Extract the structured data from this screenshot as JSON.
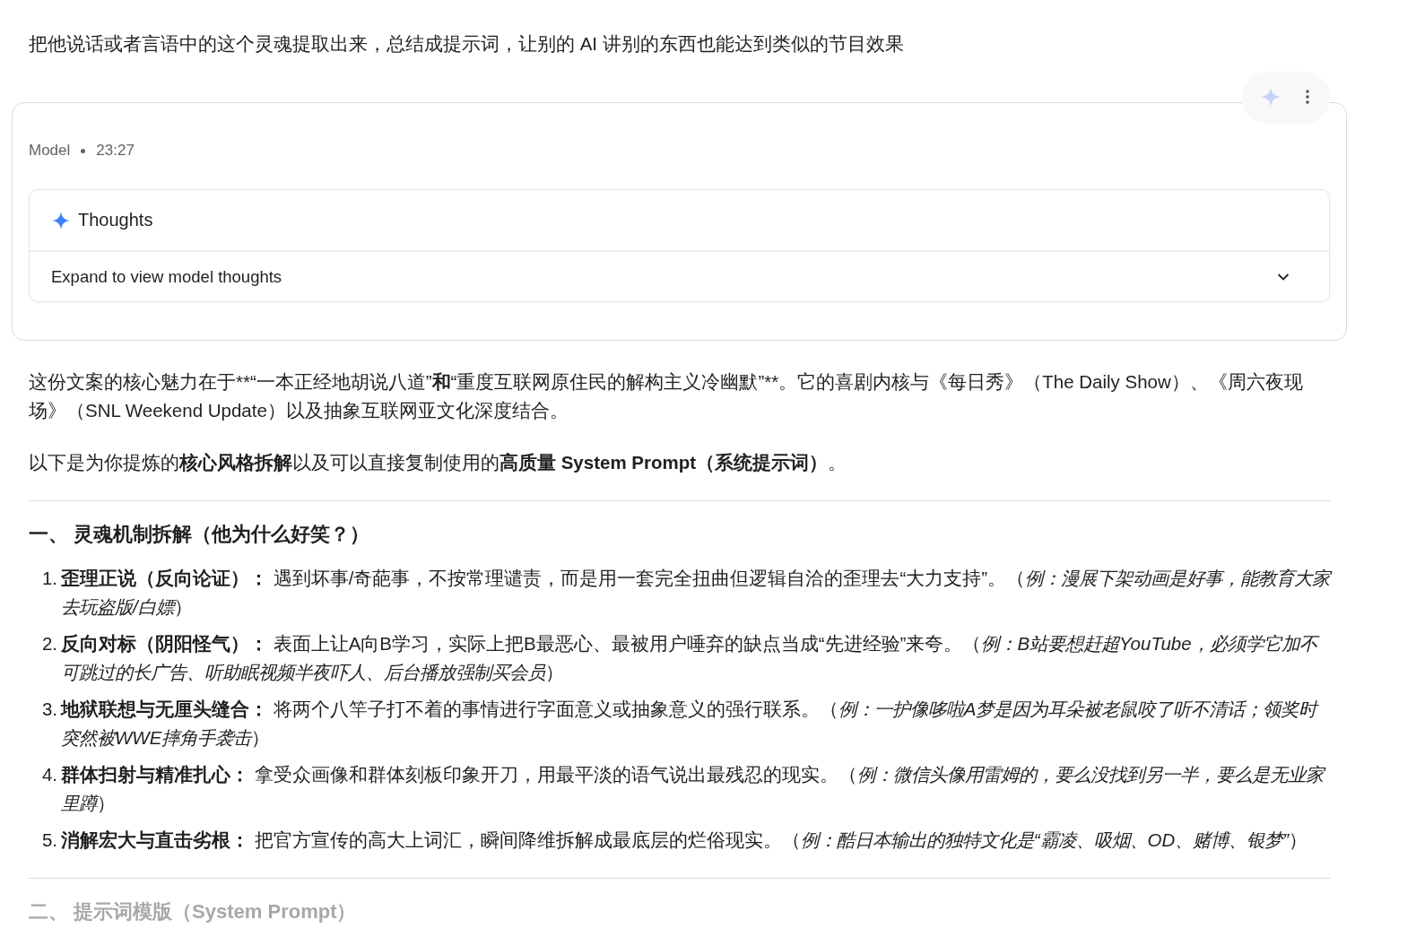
{
  "user_message": "把他说话或者言语中的这个灵魂提取出来，总结成提示词，让别的 AI 讲别的东西也能达到类似的节目效果",
  "response": {
    "author": "Model",
    "time": "23:27",
    "thoughts": {
      "title": "Thoughts",
      "expand_label": "Expand to view model thoughts",
      "expanded": false
    }
  },
  "summary": {
    "before": "这份文案的核心魅力在于**“一本正经地胡说八道”",
    "emphasis": "和",
    "after": "“重度互联网原住民的解构主义冷幽默”**。它的喜剧内核与《每日秀》（The Daily Show）、《周六夜现场》（SNL Weekend Update）以及抽象互联网亚文化深度结合。"
  },
  "intro": "以下是为你提炼的**核心风格拆解**以及可以直接复制使用的**高质量 System Prompt（系统提示词）**。",
  "sections": [
    {
      "heading": "一、 灵魂机制拆解（他为什么好笑？）",
      "faded": false,
      "items": [
        {
          "number": "1.",
          "text": "**歪理正说（反向论证）：** 遇到坏事/奇葩事，不按常理谴责，而是用一套完全扭曲但逻辑自洽的歪理去“大力支持”。（*例：漫展下架动画是好事，能教育大家去玩盗版/白嫖*）"
        },
        {
          "number": "2.",
          "text": "**反向对标（阴阳怪气）：** 表面上让A向B学习，实际上把B最恶心、最被用户唾弃的缺点当成“先进经验”来夸。（*例：B站要想赶超YouTube，必须学它加不可跳过的长广告、听助眠视频半夜吓人、后台播放强制买会员*）"
        },
        {
          "number": "3.",
          "text": "**地狱联想与无厘头缝合：** 将两个八竿子打不着的事情进行字面意义或抽象意义的强行联系。（*例：一护像哆啦A梦是因为耳朵被老鼠咬了听不清话；领奖时突然被WWE摔角手袭击*）"
        },
        {
          "number": "4.",
          "text": "**群体扫射与精准扎心：** 拿受众画像和群体刻板印象开刀，用最平淡的语气说出最残忍的现实。（*例：微信头像用雷姆的，要么没找到另一半，要么是无业家里蹲*）"
        },
        {
          "number": "5.",
          "text": "**消解宏大与直击劣根：** 把官方宣传的高大上词汇，瞬间降维拆解成最底层的烂俗现实。（*例：酷日本输出的独特文化是“霸凌、吸烟、OD、赌博、银梦”*）"
        }
      ]
    },
    {
      "heading": "二、 提示词模版（System Prompt）",
      "faded": true
    }
  ]
}
